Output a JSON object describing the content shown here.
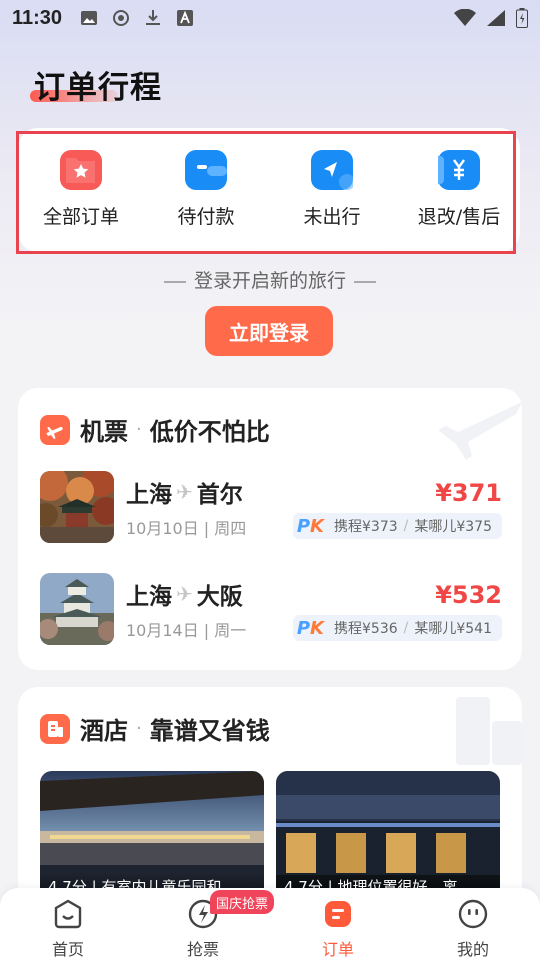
{
  "status_bar": {
    "time": "11:30"
  },
  "page": {
    "title": "订单行程"
  },
  "order_types": [
    {
      "label": "全部订单",
      "icon": "folder-star-icon",
      "color": "#f85a58"
    },
    {
      "label": "待付款",
      "icon": "wallet-icon",
      "color": "#1a8cf5"
    },
    {
      "label": "未出行",
      "icon": "paper-plane-icon",
      "color": "#1a8cf5"
    },
    {
      "label": "退改/售后",
      "icon": "yen-refund-icon",
      "color": "#1a8cf5"
    }
  ],
  "login": {
    "tip": "登录开启新的旅行",
    "button": "立即登录"
  },
  "flights": {
    "title": "机票",
    "dot": "·",
    "subtitle": "低价不怕比",
    "items": [
      {
        "from": "上海",
        "to": "首尔",
        "date": "10月10日 | 周四",
        "price": "¥371",
        "compare_a": "携程¥373",
        "compare_b": "某哪儿¥375"
      },
      {
        "from": "上海",
        "to": "大阪",
        "date": "10月14日 | 周一",
        "price": "¥532",
        "compare_a": "携程¥536",
        "compare_b": "某哪儿¥541"
      }
    ],
    "pk_p": "P",
    "pk_k": "K",
    "sep": "/"
  },
  "hotels": {
    "title": "酒店",
    "dot": "·",
    "subtitle": "靠谱又省钱",
    "items": [
      {
        "score": "4.7分 | 有室内儿童乐园和…"
      },
      {
        "score": "4.7分 | 地理位置很好，离…"
      }
    ]
  },
  "tabs": [
    {
      "label": "首页",
      "icon": "home-face-icon"
    },
    {
      "label": "抢票",
      "icon": "lightning-circle-icon"
    },
    {
      "label": "订单",
      "icon": "order-list-icon",
      "active": true
    },
    {
      "label": "我的",
      "icon": "profile-face-icon"
    }
  ],
  "tab_badge": "国庆抢票",
  "colors": {
    "accent": "#ff6a4a",
    "price": "#f04646",
    "blue": "#1a8cf5",
    "highlight": "#e8434e"
  }
}
